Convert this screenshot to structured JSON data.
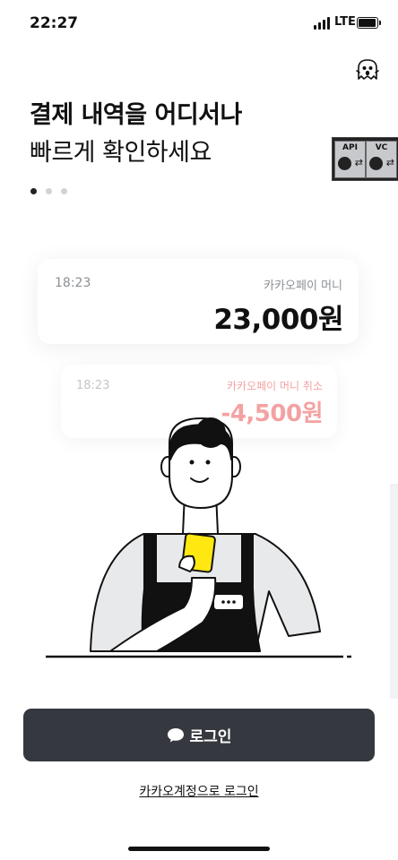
{
  "status_bar": {
    "time": "22:27",
    "network": "LTE"
  },
  "header": {
    "title": "결제 내역을 어디서나",
    "subtitle": "빠르게 확인하세요"
  },
  "pager": {
    "total": 3,
    "current": 1
  },
  "debug_panel": {
    "api_label": "API",
    "vc_label": "VC"
  },
  "cards": [
    {
      "time": "18:23",
      "type": "카카오페이 머니",
      "amount": "23,000원"
    },
    {
      "time": "18:23",
      "type": "카카오페이 머니 취소",
      "amount": "-4,500원"
    }
  ],
  "login": {
    "label": "로그인",
    "icon": "chat-bubble-icon"
  },
  "kakao_login_link": {
    "label": "카카오계정으로 로그인"
  },
  "colors": {
    "button_bg": "#35393f",
    "phone_yellow": "#ffe812",
    "cancel_red": "#f3a2a2"
  }
}
